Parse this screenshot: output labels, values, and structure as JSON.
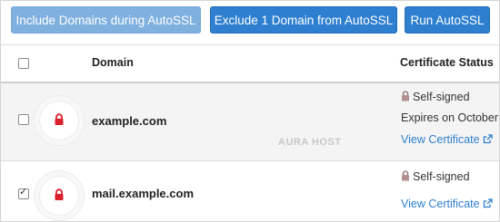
{
  "toolbar": {
    "include_label": "Include Domains during AutoSSL",
    "exclude_label": "Exclude 1 Domain from AutoSSL",
    "run_label": "Run AutoSSL"
  },
  "table": {
    "columns": {
      "domain": "Domain",
      "certificate_status": "Certificate Status"
    },
    "rows": [
      {
        "domain": "example.com",
        "checked": false,
        "status": "Self-signed",
        "expires": "Expires on October",
        "link": "View Certificate"
      },
      {
        "domain": "mail.example.com",
        "checked": true,
        "status": "Self-signed",
        "link": "View Certificate"
      }
    ]
  },
  "watermark": "AURA HOST",
  "colors": {
    "primary": "#2e7fcf",
    "disabled": "#7fb0de",
    "lock": "#d9202b",
    "link": "#2e7fcf"
  },
  "icons": [
    "lock-icon",
    "external-link-icon",
    "checkbox"
  ]
}
